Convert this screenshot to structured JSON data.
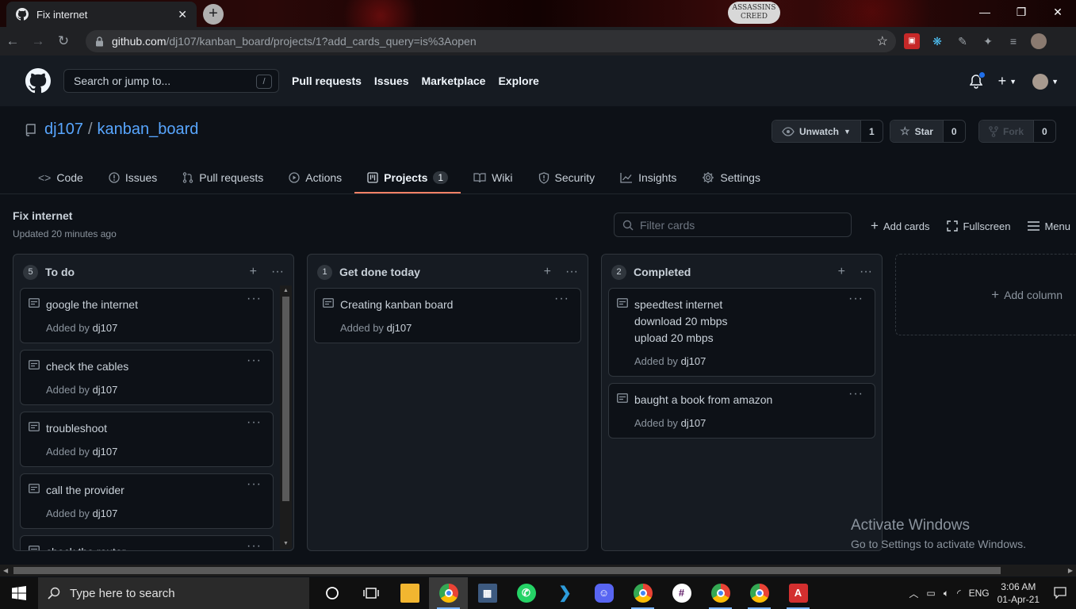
{
  "browser": {
    "tab_title": "Fix internet",
    "tab_close": "✕",
    "new_tab": "+",
    "brand_logo_line1": "ASSASSINS",
    "brand_logo_line2": "CREED",
    "url_host": "github.com",
    "url_path": "/dj107/kanban_board/projects/1?add_cards_query=is%3Aopen",
    "window_minimize": "—",
    "window_restore": "❐",
    "window_close": "✕"
  },
  "github_header": {
    "search_placeholder": "Search or jump to...",
    "search_shortcut": "/",
    "nav": [
      "Pull requests",
      "Issues",
      "Marketplace",
      "Explore"
    ],
    "plus": "+"
  },
  "repo": {
    "owner": "dj107",
    "separator": "/",
    "name": "kanban_board",
    "watch": {
      "label": "Unwatch",
      "count": "1"
    },
    "star": {
      "label": "Star",
      "count": "0"
    },
    "fork": {
      "label": "Fork",
      "count": "0"
    },
    "tabs": [
      {
        "label": "Code",
        "icon": "code-icon"
      },
      {
        "label": "Issues",
        "icon": "issue-icon"
      },
      {
        "label": "Pull requests",
        "icon": "pull-request-icon"
      },
      {
        "label": "Actions",
        "icon": "play-icon"
      },
      {
        "label": "Projects",
        "icon": "project-icon",
        "counter": "1",
        "active": true
      },
      {
        "label": "Wiki",
        "icon": "book-icon"
      },
      {
        "label": "Security",
        "icon": "shield-icon"
      },
      {
        "label": "Insights",
        "icon": "graph-icon"
      },
      {
        "label": "Settings",
        "icon": "gear-icon"
      }
    ]
  },
  "project": {
    "name": "Fix internet",
    "updated": "Updated 20 minutes ago",
    "filter_placeholder": "Filter cards",
    "add_cards": "Add cards",
    "fullscreen": "Fullscreen",
    "menu": "Menu",
    "columns": [
      {
        "count": "5",
        "name": "To do",
        "cards": [
          {
            "lines": [
              "google the internet"
            ],
            "added_by": "Added by",
            "user": "dj107"
          },
          {
            "lines": [
              "check the cables"
            ],
            "added_by": "Added by",
            "user": "dj107"
          },
          {
            "lines": [
              "troubleshoot"
            ],
            "added_by": "Added by",
            "user": "dj107"
          },
          {
            "lines": [
              "call the provider"
            ],
            "added_by": "Added by",
            "user": "dj107"
          },
          {
            "lines": [
              "check the router"
            ],
            "added_by": "",
            "user": ""
          }
        ]
      },
      {
        "count": "1",
        "name": "Get done today",
        "cards": [
          {
            "lines": [
              "Creating kanban board"
            ],
            "added_by": "Added by",
            "user": "dj107"
          }
        ]
      },
      {
        "count": "2",
        "name": "Completed",
        "cards": [
          {
            "lines": [
              "speedtest internet",
              "download 20 mbps",
              "upload 20 mbps"
            ],
            "added_by": "Added by",
            "user": "dj107"
          },
          {
            "lines": [
              "baught a book from amazon"
            ],
            "added_by": "Added by",
            "user": "dj107"
          }
        ]
      }
    ],
    "add_column": "Add column",
    "more": "···",
    "add": "+"
  },
  "watermark": {
    "line1": "Activate Windows",
    "line2": "Go to Settings to activate Windows."
  },
  "taskbar": {
    "search_placeholder": "Type here to search",
    "lang": "ENG",
    "time": "3:06 AM",
    "date": "01-Apr-21"
  },
  "colors": {
    "background": "#0d1117",
    "header": "#161b22",
    "link": "#58a6ff",
    "active_tab_underline": "#f78166",
    "notification_dot": "#1f6feb"
  }
}
